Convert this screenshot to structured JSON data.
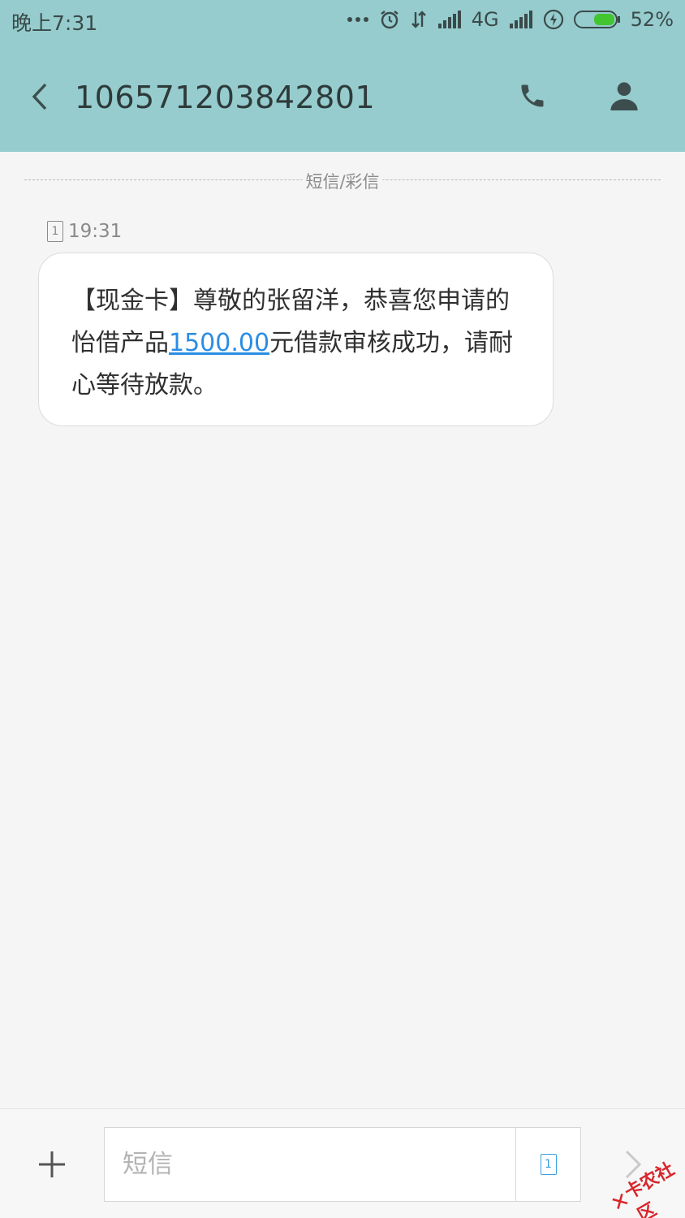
{
  "status_bar": {
    "time": "晚上7:31",
    "network": "4G",
    "battery": "52%"
  },
  "header": {
    "title": "106571203842801"
  },
  "thread": {
    "divider_label": "短信/彩信",
    "message": {
      "sim": "1",
      "time": "19:31",
      "text_before": "【现金卡】尊敬的张留洋，恭喜您申请的怡借产品",
      "amount_link": "1500.00",
      "text_after": "元借款审核成功，请耐心等待放款。"
    }
  },
  "composer": {
    "placeholder": "短信",
    "sim_label": "1"
  },
  "watermark": {
    "text": "卡农社区"
  },
  "colors": {
    "header_bg": "#96cccd",
    "link": "#2b8de3",
    "sim_accent": "#37a0e0"
  }
}
